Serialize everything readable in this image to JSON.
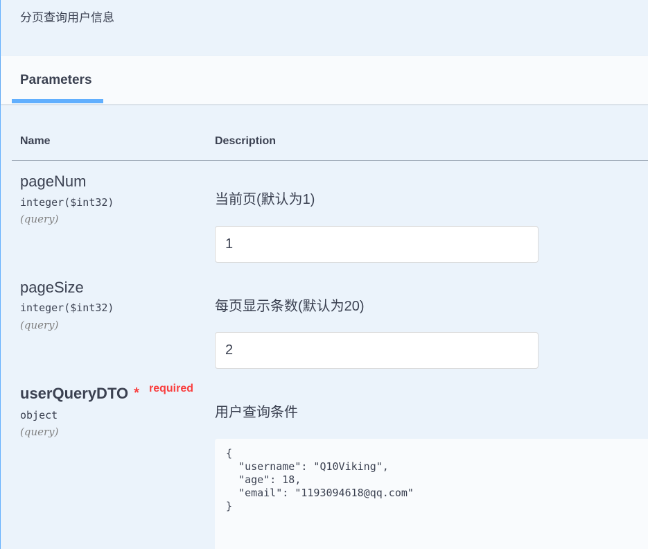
{
  "operation": {
    "summary": "分页查询用户信息"
  },
  "tabs": {
    "parameters_label": "Parameters"
  },
  "columns": {
    "name": "Name",
    "description": "Description"
  },
  "params": [
    {
      "name": "pageNum",
      "type": "integer($int32)",
      "in": "(query)",
      "description": "当前页(默认为1)",
      "value": "1"
    },
    {
      "name": "pageSize",
      "type": "integer($int32)",
      "in": "(query)",
      "description": "每页显示条数(默认为20)",
      "value": "2"
    },
    {
      "name": "userQueryDTO",
      "required_star": "*",
      "required_label": "required",
      "type": "object",
      "in": "(query)",
      "description": "用户查询条件",
      "value": "{\n  \"username\": \"Q10Viking\",\n  \"age\": 18,\n  \"email\": \"1193094618@qq.com\"\n}"
    }
  ],
  "colors": {
    "accent": "#61affe",
    "required": "#f93e3e",
    "text": "#3b4151",
    "background": "#ebf3fb"
  }
}
